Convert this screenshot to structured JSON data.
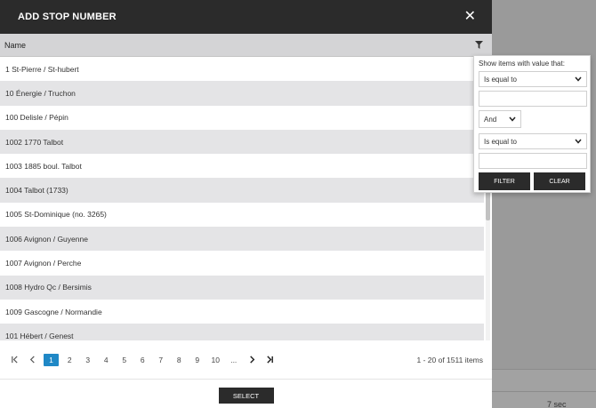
{
  "modal": {
    "title": "ADD STOP NUMBER",
    "close_label": "✕"
  },
  "grid": {
    "column_header": "Name",
    "rows": [
      "1 St-Pierre / St-hubert",
      "10 Énergie / Truchon",
      "100 Delisle / Pépin",
      "1002 1770 Talbot",
      "1003 1885 boul. Talbot",
      "1004 Talbot (1733)",
      "1005 St-Dominique (no. 3265)",
      "1006 Avignon / Guyenne",
      "1007 Avignon / Perche",
      "1008 Hydro Qc / Bersimis",
      "1009 Gascogne / Normandie",
      "101 Hébert / Genest"
    ]
  },
  "pager": {
    "pages": [
      "1",
      "2",
      "3",
      "4",
      "5",
      "6",
      "7",
      "8",
      "9",
      "10",
      "..."
    ],
    "active_page": "1",
    "info": "1 - 20 of 1511 items"
  },
  "footer": {
    "select_label": "SELECT"
  },
  "filter": {
    "title": "Show items with value that:",
    "operator1": "Is equal to",
    "logic": "And",
    "operator2": "Is equal to",
    "filter_label": "FILTER",
    "clear_label": "CLEAR"
  },
  "background": {
    "cell_text": "7 sec"
  },
  "colors": {
    "header_bg": "#2b2b2b",
    "accent": "#1f88c6",
    "row_alt": "#e4e4e6"
  }
}
